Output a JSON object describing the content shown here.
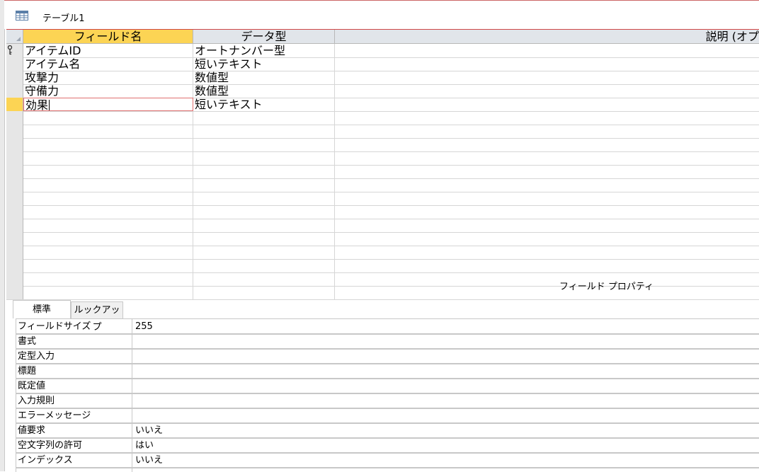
{
  "title": {
    "icon": "table-icon",
    "text": "テーブル1"
  },
  "grid": {
    "columns": [
      "フィールド名",
      "データ型",
      "説明 (オプ"
    ],
    "rows": [
      {
        "name": "アイテムID",
        "type": "オートナンバー型",
        "desc": ""
      },
      {
        "name": "アイテム名",
        "type": "短いテキスト",
        "desc": ""
      },
      {
        "name": "攻撃力",
        "type": "数値型",
        "desc": ""
      },
      {
        "name": "守備力",
        "type": "数値型",
        "desc": ""
      },
      {
        "name": "効果",
        "type": "短いテキスト",
        "desc": ""
      }
    ],
    "primary_key_row": 0,
    "current_row": 4
  },
  "properties": {
    "title": "フィールド プロパティ",
    "tabs": [
      "標準",
      "ルックアップ"
    ],
    "selected_tab": 0,
    "rows": [
      {
        "label": "フィールドサイズ",
        "value": "255"
      },
      {
        "label": "書式",
        "value": ""
      },
      {
        "label": "定型入力",
        "value": ""
      },
      {
        "label": "標題",
        "value": ""
      },
      {
        "label": "既定値",
        "value": ""
      },
      {
        "label": "入力規則",
        "value": ""
      },
      {
        "label": "エラーメッセージ",
        "value": ""
      },
      {
        "label": "値要求",
        "value": "いいえ"
      },
      {
        "label": "空文字列の許可",
        "value": "はい"
      },
      {
        "label": "インデックス",
        "value": "いいえ"
      }
    ]
  },
  "colors": {
    "accent": "#fcd454",
    "header": "#e1e5ea",
    "edit_border": "#e07070"
  }
}
